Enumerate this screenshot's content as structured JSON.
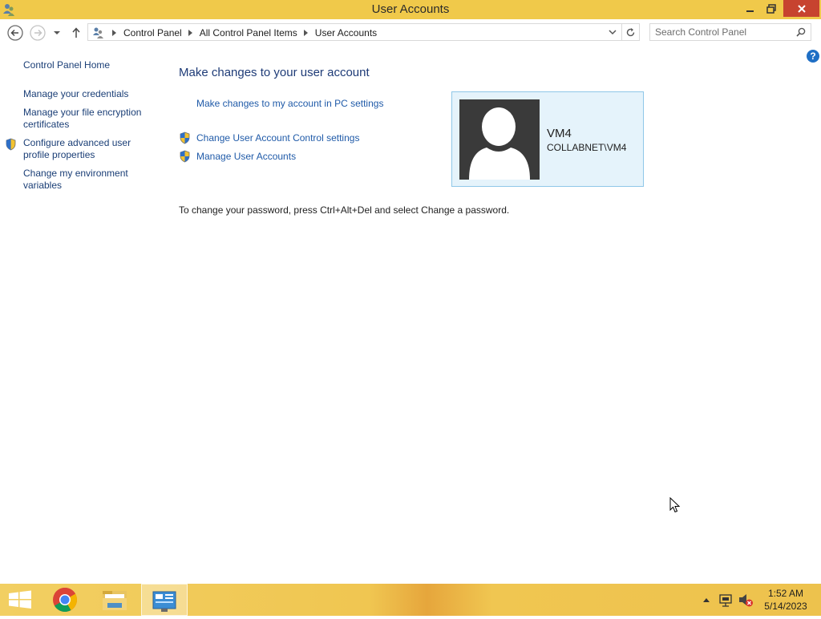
{
  "window": {
    "title": "User Accounts"
  },
  "addressbar": {
    "crumbs": [
      "Control Panel",
      "All Control Panel Items",
      "User Accounts"
    ],
    "search_placeholder": "Search Control Panel"
  },
  "left_pane": {
    "home": "Control Panel Home",
    "links": [
      "Manage your credentials",
      "Manage your file encryption",
      "certificates",
      "Configure advanced user",
      "profile properties",
      "Change my environment",
      "variables"
    ]
  },
  "main": {
    "heading": "Make changes to your user account",
    "pc_settings_link": "Make changes to my account in PC settings",
    "uac_link": "Change User Account Control settings",
    "manage_link": "Manage User Accounts",
    "password_note": "To change your password, press Ctrl+Alt+Del and select Change a password."
  },
  "user": {
    "name": "VM4",
    "domain": "COLLABNET\\VM4"
  },
  "help_label": "?",
  "taskbar": {
    "time": "1:52 AM",
    "date": "5/14/2023"
  },
  "colors": {
    "titlebar": "#f0c94a",
    "close_button": "#c7432f",
    "link": "#1f5aa8",
    "heading": "#1e3b77",
    "tile_bg": "#e5f3fb",
    "tile_border": "#8fc7e8"
  }
}
